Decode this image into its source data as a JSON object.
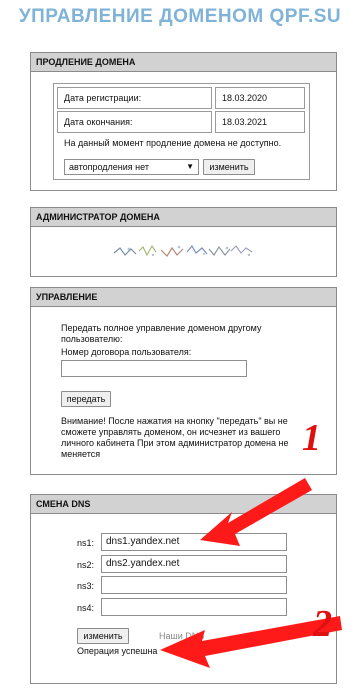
{
  "page": {
    "title": "УПРАВЛЕНИЕ ДОМЕНОМ QPF.SU"
  },
  "renewal": {
    "header": "ПРОДЛЕНИЕ ДОМЕНА",
    "reg_label": "Дата регистрации:",
    "reg_value": "18.03.2020",
    "end_label": "Дата окончания:",
    "end_value": "18.03.2021",
    "notice": "На данный момент продление домена не доступно.",
    "select_value": "автопродления нет",
    "change_button": "изменить"
  },
  "admin": {
    "header": "АДМИНИСТРАТОР ДОМЕНА"
  },
  "management": {
    "header": "УПРАВЛЕНИЕ",
    "transfer_text": "Передать полное управление доменом другому пользователю:",
    "contract_label": "Номер договора пользователя:",
    "contract_value": "",
    "transfer_button": "передать",
    "warning": "Внимание! После нажатия на кнопку \"передать\" вы не сможете управлять доменом, он исчезнет из вашего личного кабинета При этом администратор домена не меняется"
  },
  "dns": {
    "header": "СМЕНА DNS",
    "fields": [
      {
        "label": "ns1:",
        "value": "dns1.yandex.net"
      },
      {
        "label": "ns2:",
        "value": "dns2.yandex.net"
      },
      {
        "label": "ns3:",
        "value": ""
      },
      {
        "label": "ns4:",
        "value": ""
      }
    ],
    "change_button": "изменить",
    "hint": "Наши DNS",
    "status": "Операция успешна"
  },
  "annotations": {
    "one": "1",
    "two": "2"
  },
  "colors": {
    "title": "#7fb3d8",
    "header_bg": "#d2d2d2",
    "arrow": "#ff1a1a"
  }
}
